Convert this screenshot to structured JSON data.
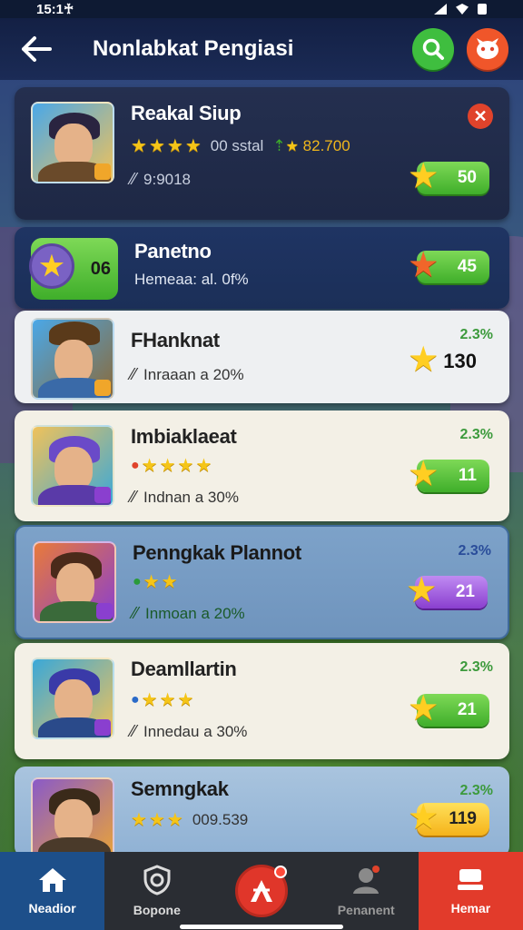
{
  "status_bar": {
    "time": "15:1♰"
  },
  "header": {
    "title": "Nonlabkat Pengiasi"
  },
  "cards": [
    {
      "title": "Reakal Siup",
      "stars": 4,
      "stat": "00 sstal",
      "score": "82.700",
      "meta": "9:9018",
      "pill": "50"
    },
    {
      "title": "Panetno",
      "coin_value": "06",
      "meta": "Hemeaa: al. 0f%",
      "pill": "45"
    },
    {
      "title": "FHanknat",
      "percent": "2.3%",
      "meta": "Inraaan a 20%",
      "pill": "130"
    },
    {
      "title": "Imbiaklaeat",
      "percent": "2.3%",
      "stars": 4,
      "meta": "Indnan a 30%",
      "pill": "11"
    },
    {
      "title": "Penngkak Plannot",
      "percent": "2.3%",
      "stars": 2,
      "meta": "Inmoan a 20%",
      "pill": "21"
    },
    {
      "title": "Deamllartin",
      "percent": "2.3%",
      "stars": 3,
      "meta": "Innedau a 30%",
      "pill": "21"
    },
    {
      "title": "Semngkak",
      "percent": "2.3%",
      "stars": 3,
      "stat": "009.539",
      "pill": "119"
    }
  ],
  "nav": [
    {
      "label": "Neadior"
    },
    {
      "label": "Bopone"
    },
    {
      "label": ""
    },
    {
      "label": "Penanent"
    },
    {
      "label": "Hemar"
    }
  ],
  "colors": {
    "header_bg": "#132044",
    "accent_green": "#3fae2a",
    "accent_red": "#e23b2b",
    "star_gold": "#f5c518"
  }
}
